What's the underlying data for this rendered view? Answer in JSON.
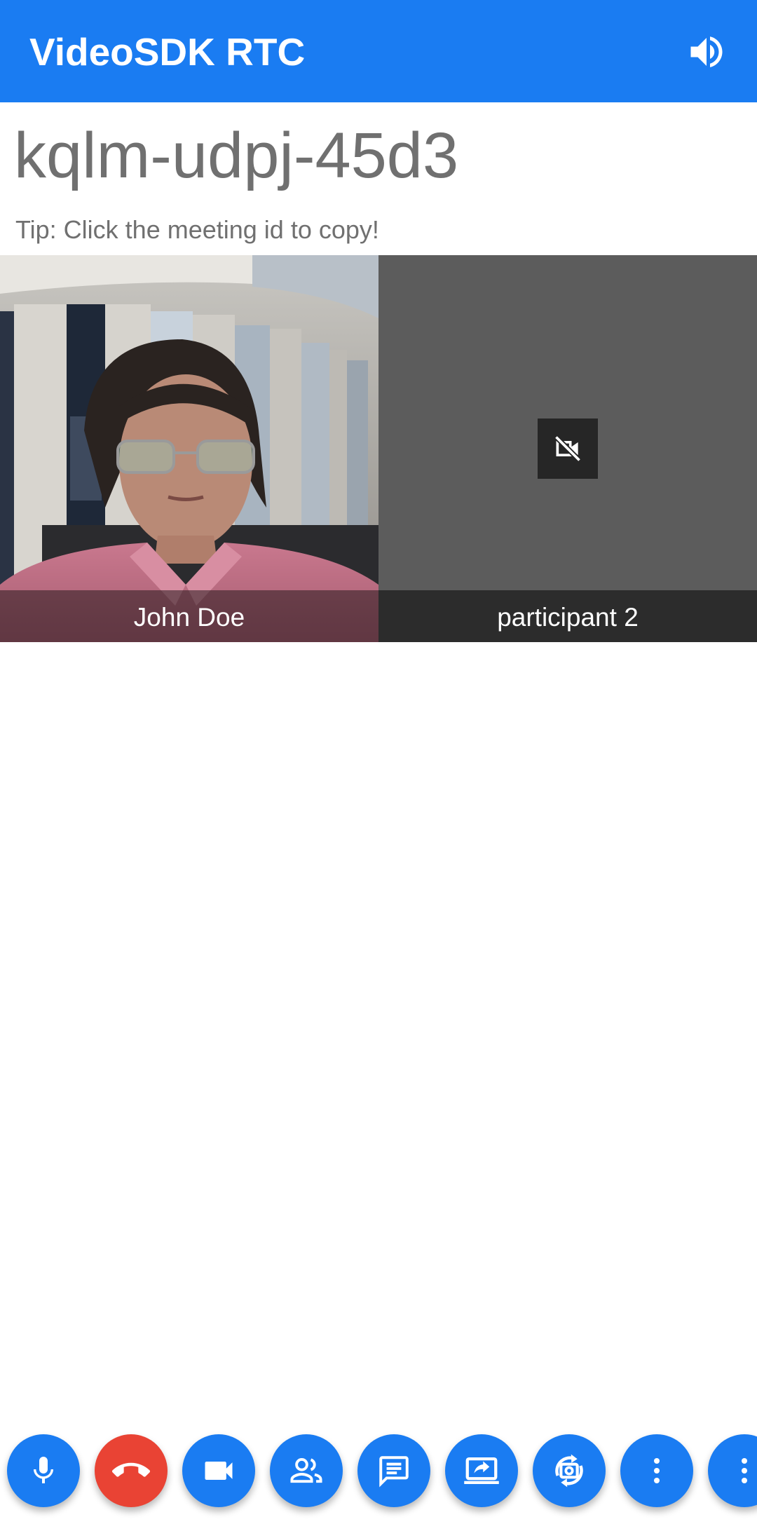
{
  "appbar": {
    "title": "VideoSDK RTC",
    "speaker_icon": "volume-up-icon"
  },
  "meeting": {
    "id": "kqlm-udpj-45d3",
    "tip": "Tip: Click the meeting id to copy!"
  },
  "participants": [
    {
      "name": "John Doe",
      "video": "on"
    },
    {
      "name": "participant 2",
      "video": "off",
      "icon": "videocam-off-icon"
    }
  ],
  "controls": [
    {
      "icon": "mic-icon"
    },
    {
      "icon": "call-end-icon"
    },
    {
      "icon": "videocam-icon"
    },
    {
      "icon": "participants-icon"
    },
    {
      "icon": "chat-icon"
    },
    {
      "icon": "screen-share-icon"
    },
    {
      "icon": "switch-camera-icon"
    },
    {
      "icon": "more-vert-icon"
    },
    {
      "icon": "more-vert-icon"
    }
  ],
  "colors": {
    "primary": "#1a7cf2",
    "end_call": "#e94334",
    "tile_off_bg": "#5c5c5c"
  }
}
